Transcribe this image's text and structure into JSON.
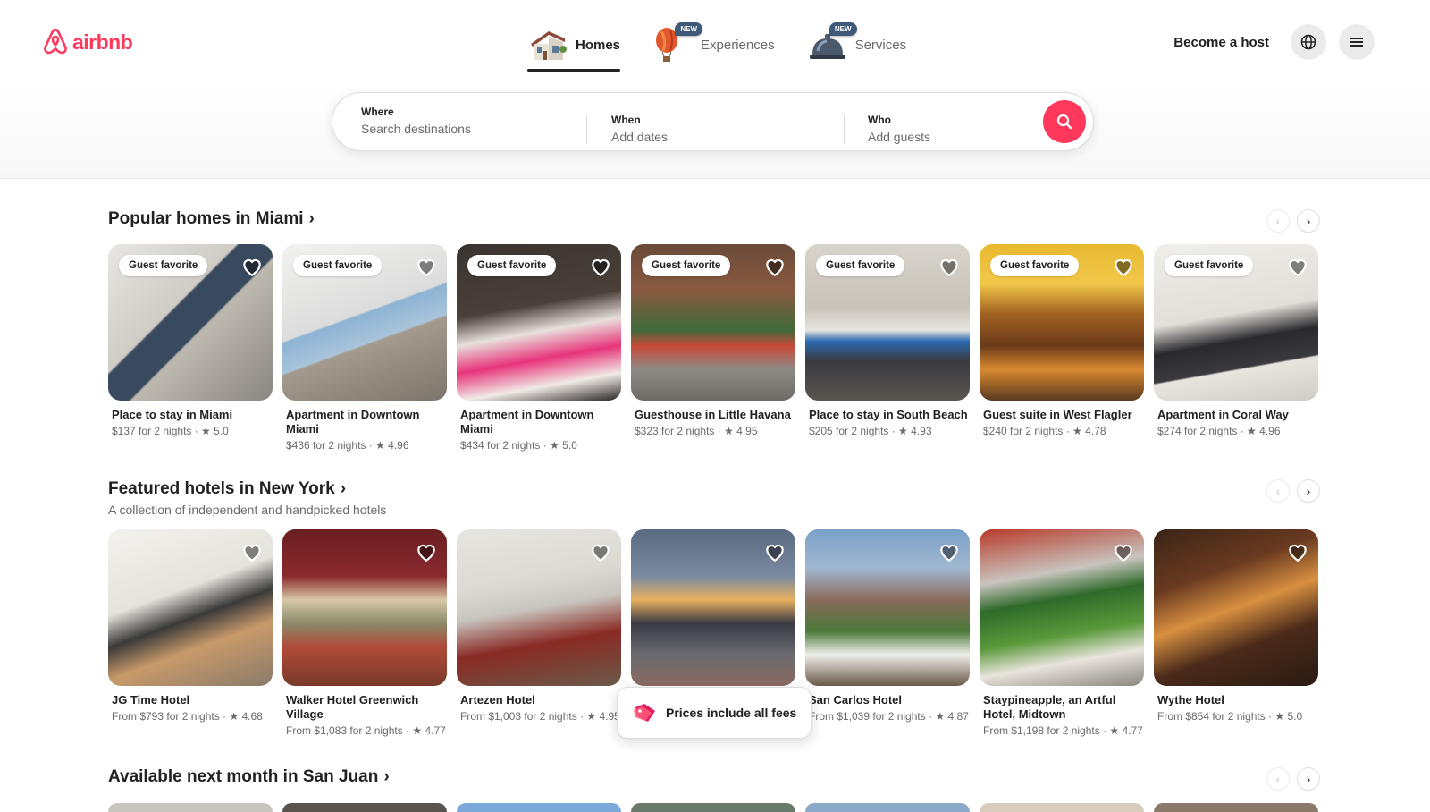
{
  "brand": {
    "name": "airbnb",
    "color": "#ff385c"
  },
  "nav": [
    {
      "label": "Homes",
      "icon": "house-icon",
      "active": true,
      "new": ""
    },
    {
      "label": "Experiences",
      "icon": "hot-air-balloon-icon",
      "active": false,
      "new": "NEW"
    },
    {
      "label": "Services",
      "icon": "service-bell-icon",
      "active": false,
      "new": "NEW"
    }
  ],
  "header_actions": {
    "host_label": "Become a host",
    "globe_icon": "globe-icon",
    "menu_icon": "hamburger-menu-icon"
  },
  "search": {
    "where_label": "Where",
    "where_placeholder": "Search destinations",
    "when_label": "When",
    "when_placeholder": "Add dates",
    "who_label": "Who",
    "who_placeholder": "Add guests",
    "button_icon": "search-icon"
  },
  "sections": [
    {
      "title": "Popular homes in Miami",
      "subtitle": "",
      "cards": [
        {
          "title": "Place to stay in Miami",
          "meta": "$137 for 2 nights · ★ 5.0",
          "badge": "Guest favorite"
        },
        {
          "title": "Apartment in Downtown Miami",
          "meta": "$436 for 2 nights · ★ 4.96",
          "badge": "Guest favorite"
        },
        {
          "title": "Apartment in Downtown Miami",
          "meta": "$434 for 2 nights · ★ 5.0",
          "badge": "Guest favorite"
        },
        {
          "title": "Guesthouse in Little Havana",
          "meta": "$323 for 2 nights · ★ 4.95",
          "badge": "Guest favorite"
        },
        {
          "title": "Place to stay in South Beach",
          "meta": "$205 for 2 nights · ★ 4.93",
          "badge": "Guest favorite"
        },
        {
          "title": "Guest suite in West Flagler",
          "meta": "$240 for 2 nights · ★ 4.78",
          "badge": "Guest favorite"
        },
        {
          "title": "Apartment in Coral Way",
          "meta": "$274 for 2 nights · ★ 4.96",
          "badge": "Guest favorite"
        }
      ]
    },
    {
      "title": "Featured hotels in New York",
      "subtitle": "A collection of independent and handpicked hotels",
      "cards": [
        {
          "title": "JG Time Hotel",
          "meta": "From $793 for 2 nights · ★ 4.68",
          "badge": ""
        },
        {
          "title": "Walker Hotel Greenwich Village",
          "meta": "From $1,083 for 2 nights · ★ 4.77",
          "badge": ""
        },
        {
          "title": "Artezen Hotel",
          "meta": "From $1,003 for 2 nights · ★ 4.95",
          "badge": ""
        },
        {
          "title": "",
          "meta": "",
          "badge": ""
        },
        {
          "title": "San Carlos Hotel",
          "meta": "From $1,039 for 2 nights · ★ 4.87",
          "badge": ""
        },
        {
          "title": "Staypineapple, an Artful Hotel, Midtown",
          "meta": "From $1,198 for 2 nights · ★ 4.77",
          "badge": ""
        },
        {
          "title": "Wythe Hotel",
          "meta": "From $854 for 2 nights · ★ 5.0",
          "badge": ""
        }
      ]
    },
    {
      "title": "Available next month in San Juan",
      "subtitle": "",
      "cards": []
    }
  ],
  "toast": {
    "text": "Prices include all fees",
    "icon": "price-tag-icon"
  }
}
